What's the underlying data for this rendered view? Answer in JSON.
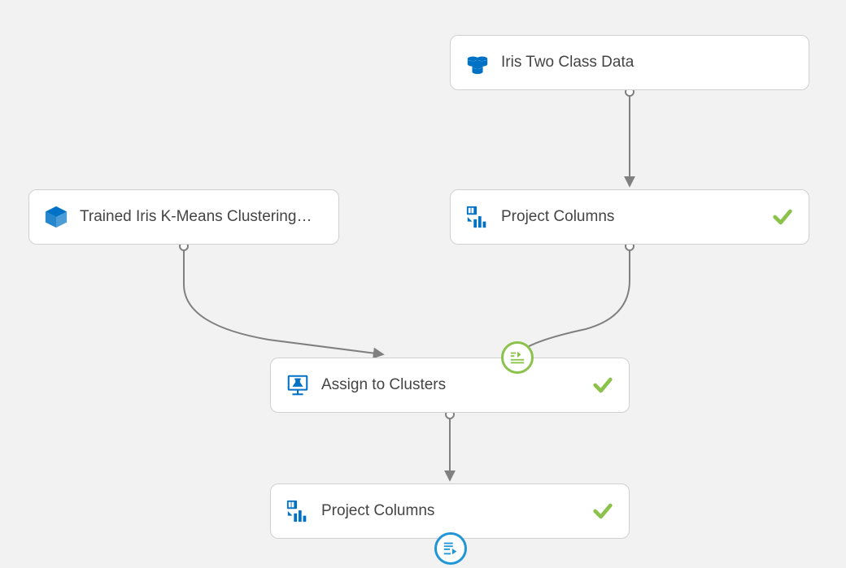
{
  "nodes": {
    "data_source": {
      "label": "Iris Two Class Data"
    },
    "trained_model": {
      "label": "Trained Iris K-Means Clustering…"
    },
    "project_columns_top": {
      "label": "Project Columns"
    },
    "assign_to_clusters": {
      "label": "Assign to Clusters"
    },
    "project_columns_bottom": {
      "label": "Project Columns"
    }
  },
  "colors": {
    "azure_blue": "#0072C6",
    "success_green": "#8BC34A",
    "badge_blue": "#2196D6",
    "edge_gray": "#808080"
  }
}
